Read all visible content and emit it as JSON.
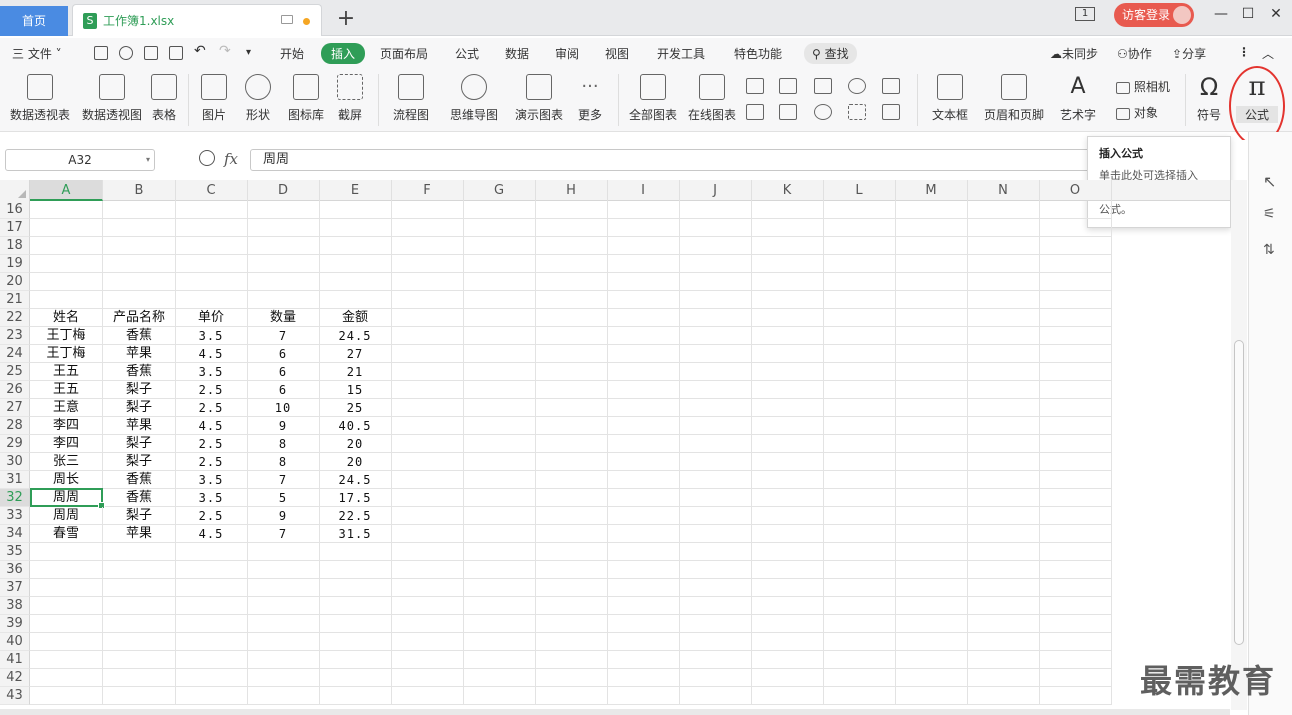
{
  "tabs": {
    "home": "首页",
    "file_title": "工作簿1.xlsx",
    "file_icon": "S",
    "new_tab": "+"
  },
  "titlebar": {
    "window_count": "1",
    "login_label": "访客登录",
    "minimize": "—",
    "maximize": "☐",
    "close": "✕"
  },
  "menu": {
    "file": "三 文件 ˅",
    "items": [
      "开始",
      "插入",
      "页面布局",
      "公式",
      "数据",
      "审阅",
      "视图",
      "开发工具",
      "特色功能"
    ],
    "active": "插入",
    "search": "查找",
    "unsynced": "未同步",
    "collab": "协作",
    "share": "分享"
  },
  "ribbon": {
    "groups": [
      {
        "label": "数据透视表",
        "icon": "pivot-table-icon"
      },
      {
        "label": "数据透视图",
        "icon": "pivot-chart-icon"
      },
      {
        "label": "表格",
        "icon": "table-icon"
      },
      {
        "label": "图片",
        "icon": "picture-icon"
      },
      {
        "label": "形状",
        "icon": "shape-icon"
      },
      {
        "label": "图标库",
        "icon": "icon-library-icon"
      },
      {
        "label": "截屏",
        "icon": "screenshot-icon"
      },
      {
        "label": "流程图",
        "icon": "flowchart-icon"
      },
      {
        "label": "思维导图",
        "icon": "mindmap-icon"
      },
      {
        "label": "演示图表",
        "icon": "demo-chart-icon"
      },
      {
        "label": "更多",
        "icon": "more-icon"
      },
      {
        "label": "全部图表",
        "icon": "all-charts-icon"
      },
      {
        "label": "在线图表",
        "icon": "online-chart-icon"
      },
      {
        "label": "文本框",
        "icon": "textbox-icon"
      },
      {
        "label": "页眉和页脚",
        "icon": "header-footer-icon"
      },
      {
        "label": "艺术字",
        "icon": "wordart-icon"
      },
      {
        "label": "照相机",
        "icon": "camera-icon"
      },
      {
        "label": "对象",
        "icon": "object-icon"
      },
      {
        "label": "符号",
        "icon": "omega-icon"
      },
      {
        "label": "公式",
        "icon": "pi-icon"
      }
    ]
  },
  "formula_bar": {
    "name_box": "A32",
    "fx": "fx",
    "value": "周周"
  },
  "tooltip": {
    "title": "插入公式",
    "body": "单击此处可选择插入MathType公式或LaTeX公式。"
  },
  "columns": [
    "A",
    "B",
    "C",
    "D",
    "E",
    "F",
    "G",
    "H",
    "I",
    "J",
    "K",
    "L",
    "M",
    "N",
    "O"
  ],
  "row_numbers": [
    "16",
    "17",
    "18",
    "19",
    "20",
    "21",
    "22",
    "23",
    "24",
    "25",
    "26",
    "27",
    "28",
    "29",
    "30",
    "31",
    "32",
    "33",
    "34",
    "35",
    "36",
    "37",
    "38",
    "39",
    "40",
    "41",
    "42",
    "43"
  ],
  "table": {
    "header": [
      "姓名",
      "产品名称",
      "单价",
      "数量",
      "金额"
    ],
    "rows": [
      [
        "王丁梅",
        "香蕉",
        "3.5",
        "7",
        "24.5"
      ],
      [
        "王丁梅",
        "苹果",
        "4.5",
        "6",
        "27"
      ],
      [
        "王五",
        "香蕉",
        "3.5",
        "6",
        "21"
      ],
      [
        "王五",
        "梨子",
        "2.5",
        "6",
        "15"
      ],
      [
        "王意",
        "梨子",
        "2.5",
        "10",
        "25"
      ],
      [
        "李四",
        "苹果",
        "4.5",
        "9",
        "40.5"
      ],
      [
        "李四",
        "梨子",
        "2.5",
        "8",
        "20"
      ],
      [
        "张三",
        "梨子",
        "2.5",
        "8",
        "20"
      ],
      [
        "周长",
        "香蕉",
        "3.5",
        "7",
        "24.5"
      ],
      [
        "周周",
        "香蕉",
        "3.5",
        "5",
        "17.5"
      ],
      [
        "周周",
        "梨子",
        "2.5",
        "9",
        "22.5"
      ],
      [
        "春雪",
        "苹果",
        "4.5",
        "7",
        "31.5"
      ]
    ]
  },
  "active_cell_row": "32",
  "watermark": "最需教育",
  "colors": {
    "accent_green": "#2f9d57",
    "home_tab_blue": "#4a8be2",
    "login_red": "#e85a4f",
    "highlight_circle": "#e3342f"
  }
}
